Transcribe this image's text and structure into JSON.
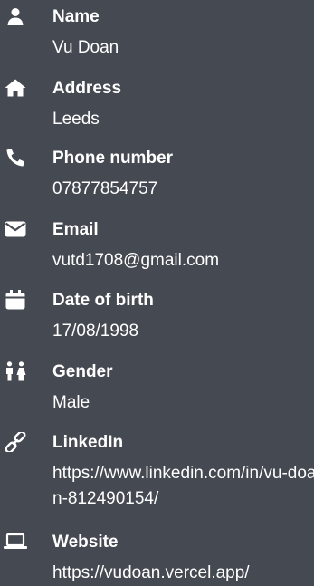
{
  "profile": {
    "items": [
      {
        "icon": "person-icon",
        "label": "Name",
        "value": "Vu Doan"
      },
      {
        "icon": "home-icon",
        "label": "Address",
        "value": "Leeds"
      },
      {
        "icon": "phone-icon",
        "label": "Phone number",
        "value": "07877854757"
      },
      {
        "icon": "envelope-icon",
        "label": "Email",
        "value": "vutd1708@gmail.com"
      },
      {
        "icon": "calendar-icon",
        "label": "Date of birth",
        "value": "17/08/1998"
      },
      {
        "icon": "restroom-icon",
        "label": "Gender",
        "value": "Male"
      },
      {
        "icon": "link-icon",
        "label": "LinkedIn",
        "value": "https://www.linkedin.com/in/vu-doan-812490154/"
      },
      {
        "icon": "laptop-icon",
        "label": "Website",
        "value": "https://vudoan.vercel.app/"
      }
    ]
  }
}
